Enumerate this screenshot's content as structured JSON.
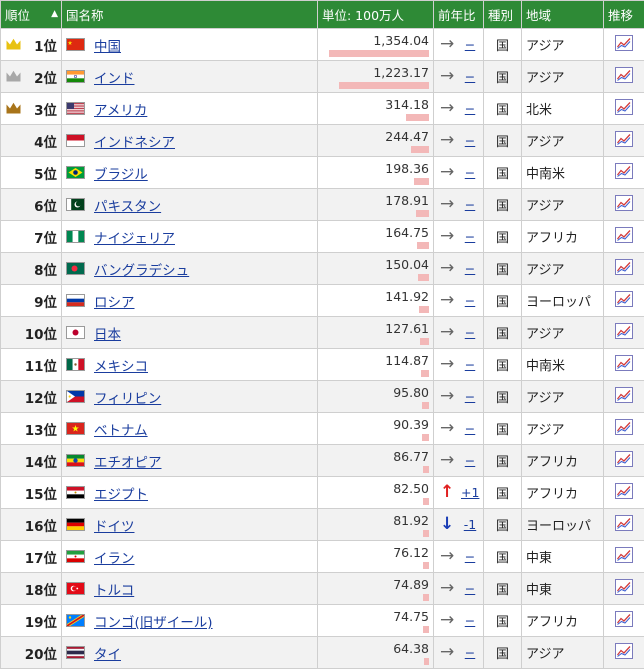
{
  "header": {
    "rank": "順位",
    "sort_glyph": "▲",
    "country": "国名称",
    "population": "単位: 100万人",
    "yoy": "前年比",
    "kind": "種別",
    "region": "地域",
    "trend": "推移"
  },
  "colors": {
    "header_bg": "#2e8a36",
    "bar": "#f3b8b8",
    "link": "#1a3d9e",
    "up": "#e02020",
    "down": "#1a3db5",
    "gold_crown": "#e8c210",
    "silver_crown": "#a8a8a8",
    "bronze_crown": "#a8741a"
  },
  "rows": [
    {
      "rank": "1位",
      "crown": "gold",
      "flag": "cn",
      "name": "中国",
      "pop": "1,354.04",
      "value": 1354.04,
      "yoy_dir": "flat",
      "yoy": "−",
      "kind": "国",
      "region": "アジア"
    },
    {
      "rank": "2位",
      "crown": "silver",
      "flag": "in",
      "name": "インド",
      "pop": "1,223.17",
      "value": 1223.17,
      "yoy_dir": "flat",
      "yoy": "−",
      "kind": "国",
      "region": "アジア"
    },
    {
      "rank": "3位",
      "crown": "bronze",
      "flag": "us",
      "name": "アメリカ",
      "pop": "314.18",
      "value": 314.18,
      "yoy_dir": "flat",
      "yoy": "−",
      "kind": "国",
      "region": "北米"
    },
    {
      "rank": "4位",
      "crown": null,
      "flag": "id",
      "name": "インドネシア",
      "pop": "244.47",
      "value": 244.47,
      "yoy_dir": "flat",
      "yoy": "−",
      "kind": "国",
      "region": "アジア"
    },
    {
      "rank": "5位",
      "crown": null,
      "flag": "br",
      "name": "ブラジル",
      "pop": "198.36",
      "value": 198.36,
      "yoy_dir": "flat",
      "yoy": "−",
      "kind": "国",
      "region": "中南米"
    },
    {
      "rank": "6位",
      "crown": null,
      "flag": "pk",
      "name": "パキスタン",
      "pop": "178.91",
      "value": 178.91,
      "yoy_dir": "flat",
      "yoy": "−",
      "kind": "国",
      "region": "アジア"
    },
    {
      "rank": "7位",
      "crown": null,
      "flag": "ng",
      "name": "ナイジェリア",
      "pop": "164.75",
      "value": 164.75,
      "yoy_dir": "flat",
      "yoy": "−",
      "kind": "国",
      "region": "アフリカ"
    },
    {
      "rank": "8位",
      "crown": null,
      "flag": "bd",
      "name": "バングラデシュ",
      "pop": "150.04",
      "value": 150.04,
      "yoy_dir": "flat",
      "yoy": "−",
      "kind": "国",
      "region": "アジア"
    },
    {
      "rank": "9位",
      "crown": null,
      "flag": "ru",
      "name": "ロシア",
      "pop": "141.92",
      "value": 141.92,
      "yoy_dir": "flat",
      "yoy": "−",
      "kind": "国",
      "region": "ヨーロッパ"
    },
    {
      "rank": "10位",
      "crown": null,
      "flag": "jp",
      "name": "日本",
      "pop": "127.61",
      "value": 127.61,
      "yoy_dir": "flat",
      "yoy": "−",
      "kind": "国",
      "region": "アジア"
    },
    {
      "rank": "11位",
      "crown": null,
      "flag": "mx",
      "name": "メキシコ",
      "pop": "114.87",
      "value": 114.87,
      "yoy_dir": "flat",
      "yoy": "−",
      "kind": "国",
      "region": "中南米"
    },
    {
      "rank": "12位",
      "crown": null,
      "flag": "ph",
      "name": "フィリピン",
      "pop": "95.80",
      "value": 95.8,
      "yoy_dir": "flat",
      "yoy": "−",
      "kind": "国",
      "region": "アジア"
    },
    {
      "rank": "13位",
      "crown": null,
      "flag": "vn",
      "name": "ベトナム",
      "pop": "90.39",
      "value": 90.39,
      "yoy_dir": "flat",
      "yoy": "−",
      "kind": "国",
      "region": "アジア"
    },
    {
      "rank": "14位",
      "crown": null,
      "flag": "et",
      "name": "エチオピア",
      "pop": "86.77",
      "value": 86.77,
      "yoy_dir": "flat",
      "yoy": "−",
      "kind": "国",
      "region": "アフリカ"
    },
    {
      "rank": "15位",
      "crown": null,
      "flag": "eg",
      "name": "エジプト",
      "pop": "82.50",
      "value": 82.5,
      "yoy_dir": "up",
      "yoy": "+1",
      "kind": "国",
      "region": "アフリカ"
    },
    {
      "rank": "16位",
      "crown": null,
      "flag": "de",
      "name": "ドイツ",
      "pop": "81.92",
      "value": 81.92,
      "yoy_dir": "down",
      "yoy": "-1",
      "kind": "国",
      "region": "ヨーロッパ"
    },
    {
      "rank": "17位",
      "crown": null,
      "flag": "ir",
      "name": "イラン",
      "pop": "76.12",
      "value": 76.12,
      "yoy_dir": "flat",
      "yoy": "−",
      "kind": "国",
      "region": "中東"
    },
    {
      "rank": "18位",
      "crown": null,
      "flag": "tr",
      "name": "トルコ",
      "pop": "74.89",
      "value": 74.89,
      "yoy_dir": "flat",
      "yoy": "−",
      "kind": "国",
      "region": "中東"
    },
    {
      "rank": "19位",
      "crown": null,
      "flag": "cd",
      "name": "コンゴ(旧ザイール)",
      "pop": "74.75",
      "value": 74.75,
      "yoy_dir": "flat",
      "yoy": "−",
      "kind": "国",
      "region": "アフリカ"
    },
    {
      "rank": "20位",
      "crown": null,
      "flag": "th",
      "name": "タイ",
      "pop": "64.38",
      "value": 64.38,
      "yoy_dir": "flat",
      "yoy": "−",
      "kind": "国",
      "region": "アジア"
    }
  ]
}
